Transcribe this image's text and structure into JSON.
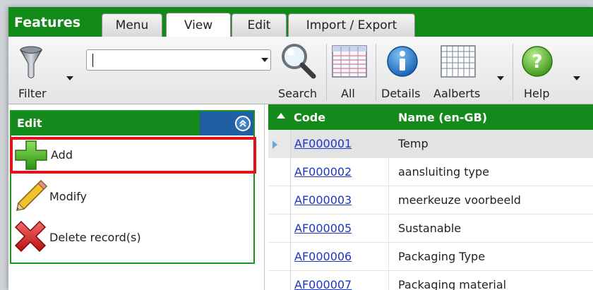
{
  "app": {
    "title": "Features"
  },
  "tabs": [
    {
      "label": "Menu",
      "active": false
    },
    {
      "label": "View",
      "active": true
    },
    {
      "label": "Edit",
      "active": false
    },
    {
      "label": "Import / Export",
      "active": false
    }
  ],
  "ribbon": {
    "filter_label": "Filter",
    "search_value": "",
    "search_label": "Search",
    "all_label": "All",
    "details_label": "Details",
    "aalberts_label": "Aalberts",
    "help_label": "Help"
  },
  "edit_panel": {
    "title": "Edit",
    "actions": [
      {
        "label": "Add",
        "icon": "plus-icon",
        "highlighted": true
      },
      {
        "label": "Modify",
        "icon": "pencil-icon",
        "highlighted": false
      },
      {
        "label": "Delete record(s)",
        "icon": "delete-x-icon",
        "highlighted": false
      }
    ]
  },
  "grid": {
    "columns": [
      "Code",
      "Name (en-GB)"
    ],
    "sort_column": "Code",
    "sort_direction": "ascending",
    "rows": [
      {
        "code": "AF000001",
        "name": "Temp",
        "selected": true
      },
      {
        "code": "AF000002",
        "name": "aansluiting type",
        "selected": false
      },
      {
        "code": "AF000003",
        "name": "meerkeuze voorbeeld",
        "selected": false
      },
      {
        "code": "AF000005",
        "name": "Sustanable",
        "selected": false
      },
      {
        "code": "AF000006",
        "name": "Packaging Type",
        "selected": false
      },
      {
        "code": "AF000007",
        "name": "Packaging material",
        "selected": false
      }
    ]
  },
  "colors": {
    "brand_green": "#128a1a",
    "header_blue": "#1f5fa2",
    "link_blue": "#1a35c8",
    "highlight_red": "#e0121a"
  }
}
